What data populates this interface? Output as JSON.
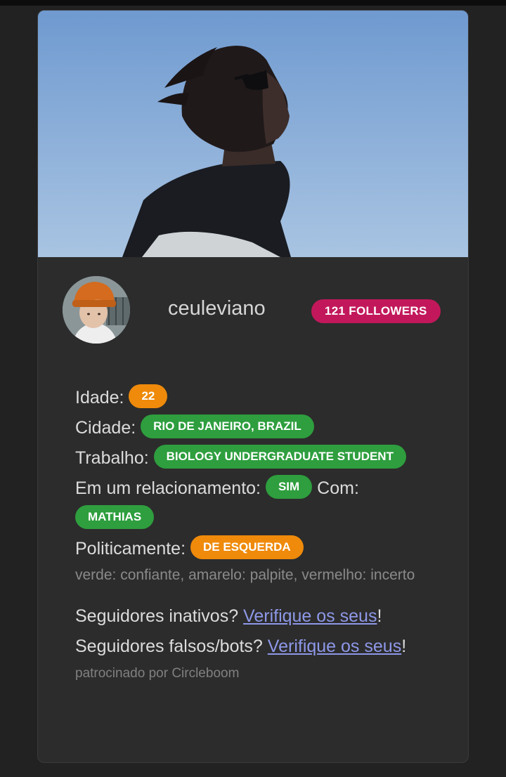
{
  "profile": {
    "username": "ceuleviano",
    "followers_label": "121 FOLLOWERS"
  },
  "fields": {
    "age_label": "Idade:",
    "age_value": "22",
    "city_label": "Cidade:",
    "city_value": "RIO DE JANEIRO, BRAZIL",
    "job_label": "Trabalho:",
    "job_value": "BIOLOGY UNDERGRADUATE STUDENT",
    "relationship_label": "Em um relacionamento:",
    "relationship_value": "SIM",
    "with_label": "Com:",
    "with_value": "MATHIAS",
    "politics_label": "Politicamente:",
    "politics_value": "DE ESQUERDA"
  },
  "legend": "verde: confiante, amarelo: palpite, vermelho: incerto",
  "promo": {
    "inactive_text": "Seguidores inativos?",
    "inactive_link": "Verifique os seus",
    "inactive_suffix": "!",
    "fake_text": "Seguidores falsos/bots?",
    "fake_link": "Verifique os seus",
    "fake_suffix": "!",
    "sponsor": "patrocinado por Circleboom"
  },
  "colors": {
    "background": "#222222",
    "card": "#2c2c2c",
    "followers_badge": "#c2185b",
    "confident_badge": "#2e9e3e",
    "guess_badge": "#ef8a0a",
    "link": "#8e98e8"
  }
}
